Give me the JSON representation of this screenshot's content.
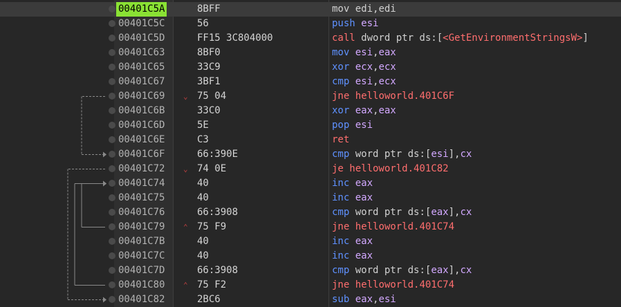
{
  "colors": {
    "background": "#272727",
    "address_column": "#2f2f2f",
    "current_address_highlight": "#8ae234",
    "arrow_lines": "#8a8a8a",
    "register": "#d2a8ff",
    "flow_mnemonic": "#5f91ff",
    "branch_mnemonic": "#ff6e6e"
  },
  "current_instruction_address": "00401C5A",
  "rows": [
    {
      "address": "00401C5A",
      "bytes": "8BFF",
      "jmark": "",
      "parts": [
        [
          "mn-def",
          "mov"
        ],
        [
          "txt",
          " edi,edi"
        ]
      ]
    },
    {
      "address": "00401C5C",
      "bytes": "56",
      "jmark": "",
      "parts": [
        [
          "mn-flow",
          "push"
        ],
        [
          "reg",
          " esi"
        ]
      ]
    },
    {
      "address": "00401C5D",
      "bytes": "FF15 3C804000",
      "jmark": "",
      "parts": [
        [
          "mn-call",
          "call"
        ],
        [
          "txt",
          " dword ptr ds:["
        ],
        [
          "lbl",
          "<GetEnvironmentStringsW>"
        ],
        [
          "txt",
          "]"
        ]
      ]
    },
    {
      "address": "00401C63",
      "bytes": "8BF0",
      "jmark": "",
      "parts": [
        [
          "mn-flow",
          "mov"
        ],
        [
          "reg",
          " esi"
        ],
        [
          "txt",
          ","
        ],
        [
          "reg",
          "eax"
        ]
      ]
    },
    {
      "address": "00401C65",
      "bytes": "33C9",
      "jmark": "",
      "parts": [
        [
          "mn-flow",
          "xor"
        ],
        [
          "reg",
          " ecx"
        ],
        [
          "txt",
          ","
        ],
        [
          "reg",
          "ecx"
        ]
      ]
    },
    {
      "address": "00401C67",
      "bytes": "3BF1",
      "jmark": "",
      "parts": [
        [
          "mn-flow",
          "cmp"
        ],
        [
          "reg",
          " esi"
        ],
        [
          "txt",
          ","
        ],
        [
          "reg",
          "ecx"
        ]
      ]
    },
    {
      "address": "00401C69",
      "bytes": "75 04",
      "jmark": "⌄",
      "parts": [
        [
          "mn-jmp",
          "jne"
        ],
        [
          "lbl",
          " helloworld.401C6F"
        ]
      ]
    },
    {
      "address": "00401C6B",
      "bytes": "33C0",
      "jmark": "",
      "parts": [
        [
          "mn-flow",
          "xor"
        ],
        [
          "reg",
          " eax"
        ],
        [
          "txt",
          ","
        ],
        [
          "reg",
          "eax"
        ]
      ]
    },
    {
      "address": "00401C6D",
      "bytes": "5E",
      "jmark": "",
      "parts": [
        [
          "mn-flow",
          "pop"
        ],
        [
          "reg",
          " esi"
        ]
      ]
    },
    {
      "address": "00401C6E",
      "bytes": "C3",
      "jmark": "",
      "parts": [
        [
          "mn-ret",
          "ret"
        ]
      ]
    },
    {
      "address": "00401C6F",
      "bytes": "66:390E",
      "jmark": "",
      "parts": [
        [
          "mn-flow",
          "cmp"
        ],
        [
          "txt",
          " word ptr ds:["
        ],
        [
          "reg",
          "esi"
        ],
        [
          "txt",
          "],"
        ],
        [
          "reg",
          "cx"
        ]
      ]
    },
    {
      "address": "00401C72",
      "bytes": "74 0E",
      "jmark": "⌄",
      "parts": [
        [
          "mn-jmp",
          "je"
        ],
        [
          "lbl",
          " helloworld.401C82"
        ]
      ]
    },
    {
      "address": "00401C74",
      "bytes": "40",
      "jmark": "",
      "parts": [
        [
          "mn-flow",
          "inc"
        ],
        [
          "reg",
          " eax"
        ]
      ]
    },
    {
      "address": "00401C75",
      "bytes": "40",
      "jmark": "",
      "parts": [
        [
          "mn-flow",
          "inc"
        ],
        [
          "reg",
          " eax"
        ]
      ]
    },
    {
      "address": "00401C76",
      "bytes": "66:3908",
      "jmark": "",
      "parts": [
        [
          "mn-flow",
          "cmp"
        ],
        [
          "txt",
          " word ptr ds:["
        ],
        [
          "reg",
          "eax"
        ],
        [
          "txt",
          "],"
        ],
        [
          "reg",
          "cx"
        ]
      ]
    },
    {
      "address": "00401C79",
      "bytes": "75 F9",
      "jmark": "⌃",
      "parts": [
        [
          "mn-jmp",
          "jne"
        ],
        [
          "lbl",
          " helloworld.401C74"
        ]
      ]
    },
    {
      "address": "00401C7B",
      "bytes": "40",
      "jmark": "",
      "parts": [
        [
          "mn-flow",
          "inc"
        ],
        [
          "reg",
          " eax"
        ]
      ]
    },
    {
      "address": "00401C7C",
      "bytes": "40",
      "jmark": "",
      "parts": [
        [
          "mn-flow",
          "inc"
        ],
        [
          "reg",
          " eax"
        ]
      ]
    },
    {
      "address": "00401C7D",
      "bytes": "66:3908",
      "jmark": "",
      "parts": [
        [
          "mn-flow",
          "cmp"
        ],
        [
          "txt",
          " word ptr ds:["
        ],
        [
          "reg",
          "eax"
        ],
        [
          "txt",
          "],"
        ],
        [
          "reg",
          "cx"
        ]
      ]
    },
    {
      "address": "00401C80",
      "bytes": "75 F2",
      "jmark": "⌃",
      "parts": [
        [
          "mn-jmp",
          "jne"
        ],
        [
          "lbl",
          " helloworld.401C74"
        ]
      ]
    },
    {
      "address": "00401C82",
      "bytes": "2BC6",
      "jmark": "",
      "parts": [
        [
          "mn-flow",
          "sub"
        ],
        [
          "reg",
          " eax"
        ],
        [
          "txt",
          ","
        ],
        [
          "reg",
          "esi"
        ]
      ]
    }
  ]
}
